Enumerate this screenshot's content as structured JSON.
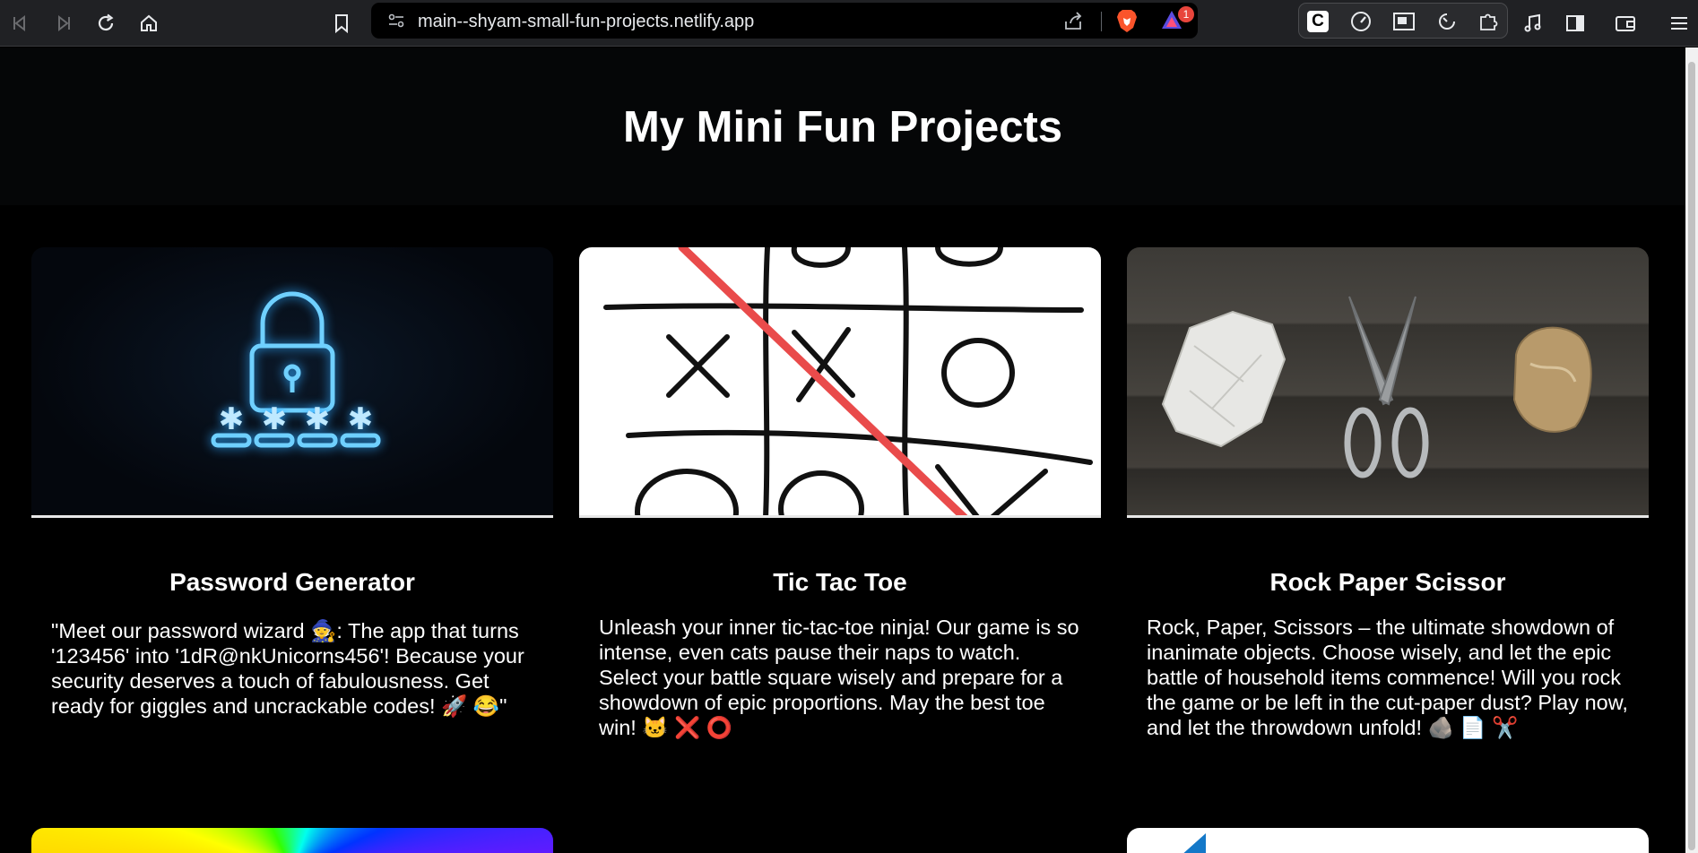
{
  "browser": {
    "url": "main--shyam-small-fun-projects.netlify.app",
    "rewards_badge": "1",
    "extension_initial": "C"
  },
  "page": {
    "title": "My Mini Fun Projects"
  },
  "projects": [
    {
      "title": "Password Generator",
      "description": "\"Meet our password wizard 🧙: The app that turns '123456' into '1dR@nkUnicorns456'! Because your security deserves a touch of fabulousness. Get ready for giggles and uncrackable codes! 🚀 😂\"",
      "image": "padlock-password-icon"
    },
    {
      "title": "Tic Tac Toe",
      "description": "Unleash your inner tic-tac-toe ninja! Our game is so intense, even cats pause their naps to watch. Select your battle square wisely and prepare for a showdown of epic proportions. May the best toe win! 🐱 ❌ ⭕",
      "image": "tic-tac-toe-board"
    },
    {
      "title": "Rock Paper Scissor",
      "description": "Rock, Paper, Scissors – the ultimate showdown of inanimate objects. Choose wisely, and let the epic battle of household items commence! Will you rock the game or be left in the cut-paper dust? Play now, and let the throwdown unfold! 🪨 📄 ✂️",
      "image": "rock-paper-scissors-photo"
    }
  ],
  "colors": {
    "background": "#000000",
    "hero": "#050607",
    "chrome": "#202124",
    "text": "#ffffff",
    "neon": "#5ec8ff"
  }
}
